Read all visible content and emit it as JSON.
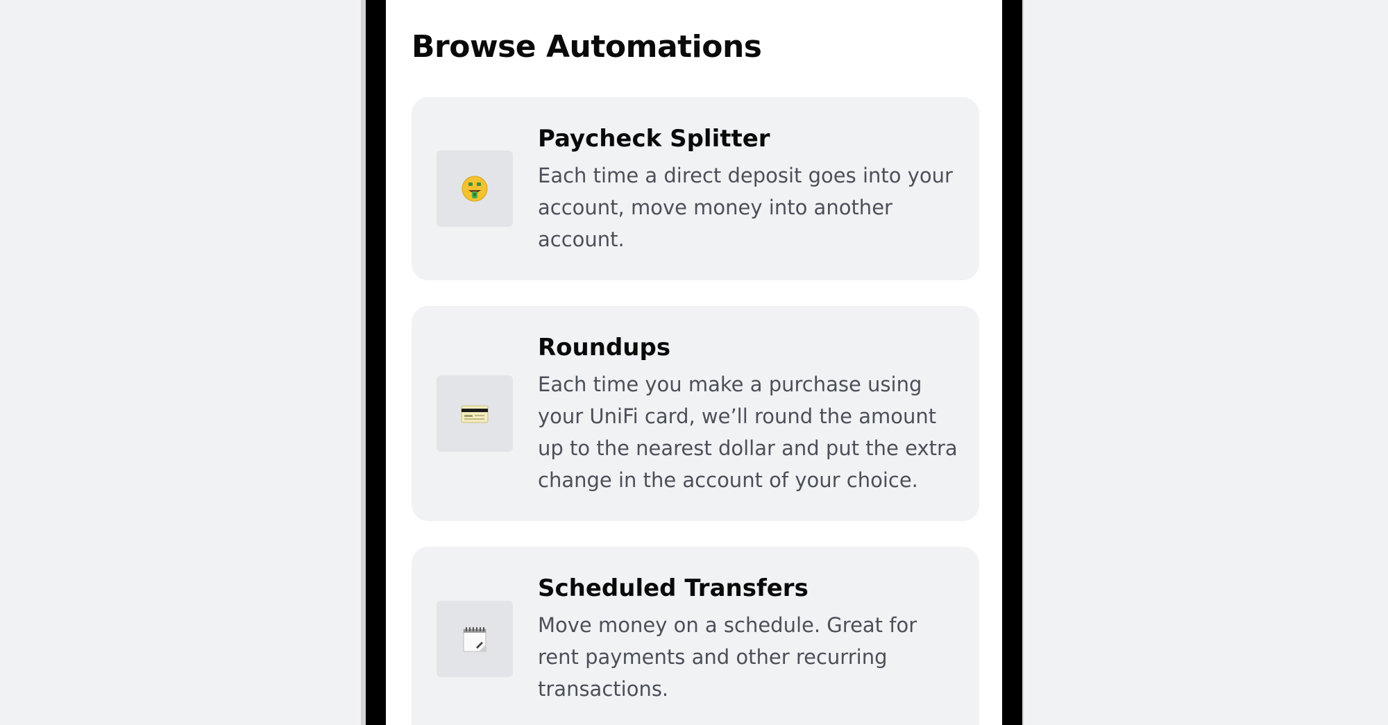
{
  "page": {
    "title": "Browse Automations"
  },
  "automations": [
    {
      "title": "Paycheck Splitter",
      "description": "Each time a direct deposit goes into your account, move money into another account.",
      "icon": "money-mouth-face-icon"
    },
    {
      "title": "Roundups",
      "description": "Each time you make a purchase using your UniFi card, we’ll round the amount up to the nearest dollar and put the extra change in the account of your choice.",
      "icon": "credit-card-icon"
    },
    {
      "title": "Scheduled Transfers",
      "description": "Move money on a schedule. Great for rent payments and other recurring transactions.",
      "icon": "spiral-notepad-icon"
    }
  ],
  "colors": {
    "background": "#f1f2f4",
    "screen": "#ffffff",
    "card": "#f1f2f4",
    "icon_tile": "#e3e4e7",
    "title_text": "#0a0a0a",
    "body_text": "#4b4f58"
  }
}
